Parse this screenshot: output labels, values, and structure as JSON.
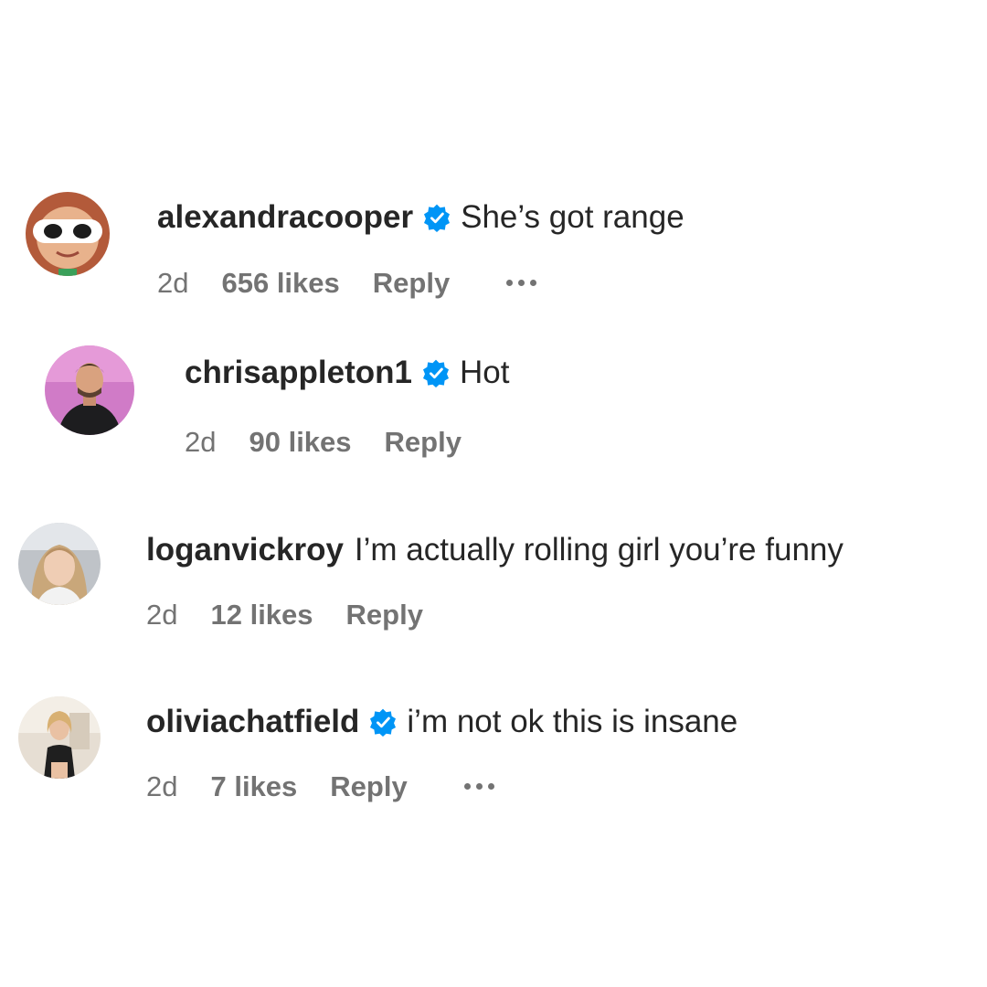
{
  "comments": [
    {
      "username": "alexandracooper",
      "verified": true,
      "text": "She’s got range",
      "time": "2d",
      "likes": "656 likes",
      "reply": "Reply",
      "has_more": true
    },
    {
      "username": "chrisappleton1",
      "verified": true,
      "text": "Hot",
      "time": "2d",
      "likes": "90 likes",
      "reply": "Reply",
      "has_more": false
    },
    {
      "username": "loganvickroy",
      "verified": false,
      "text": "I’m actually rolling girl you’re funny",
      "time": "2d",
      "likes": "12 likes",
      "reply": "Reply",
      "has_more": false
    },
    {
      "username": "oliviachatfield",
      "verified": true,
      "text": "i’m not ok this is insane",
      "time": "2d",
      "likes": "7 likes",
      "reply": "Reply",
      "has_more": true
    }
  ],
  "colors": {
    "verified_blue": "#0095f6",
    "secondary_text": "#737373",
    "primary_text": "#262626"
  }
}
